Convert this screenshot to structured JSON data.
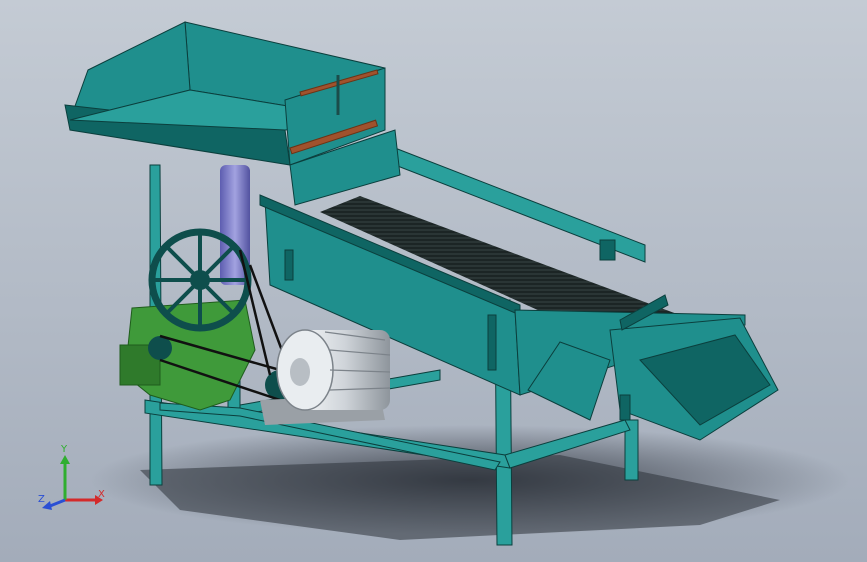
{
  "viewport": {
    "background_top": "#c4cbd4",
    "background_bottom": "#a3acba"
  },
  "model": {
    "name": "",
    "body_color": "#1f8f8d",
    "body_dark": "#0f6563",
    "frame_color": "#2aa09c",
    "screen_color": "#1e2a2a",
    "motor_color": "#e8ecef",
    "gearbox_color": "#3f9a3a",
    "cylinder_color": "#7f7fc9",
    "accent_strip": "#a0522d"
  },
  "triad": {
    "x_label": "X",
    "y_label": "Y",
    "z_label": "Z",
    "x_color": "#d42a2a",
    "y_color": "#2fae2f",
    "z_color": "#2a4fd4"
  }
}
